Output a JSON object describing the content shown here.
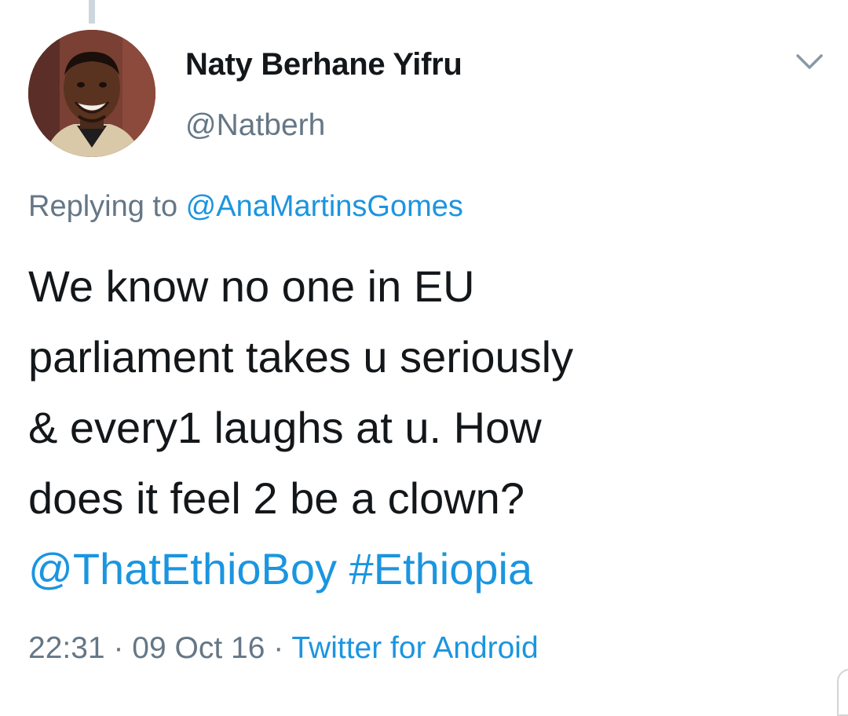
{
  "tweet": {
    "author": {
      "name": "Naty Berhane Yifru",
      "handle": "@Natberh",
      "avatar_icon": "profile-photo"
    },
    "reply_prefix": "Replying to ",
    "reply_to": "@AnaMartinsGomes",
    "text_lines": [
      "We know no one in EU",
      "parliament takes u seriously",
      "& every1 laughs at u. How",
      "does it feel 2 be a clown?"
    ],
    "mention": "@ThatEthioBoy",
    "hashtag": "#Ethiopia",
    "time": "22:31",
    "separator": " · ",
    "date": "09 Oct 16",
    "source": "Twitter for Android",
    "menu_icon": "chevron-down-icon"
  },
  "colors": {
    "text": "#14171a",
    "secondary": "#657786",
    "link": "#1b95e0",
    "background": "#ffffff",
    "thread_line": "#ccd6dd"
  }
}
